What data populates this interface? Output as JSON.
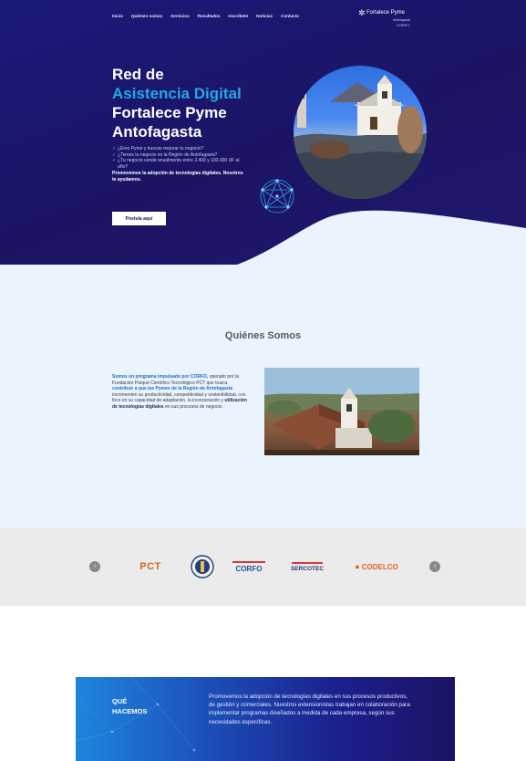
{
  "nav": {
    "items": [
      "Inicio",
      "Quiénes somos",
      "Servicios",
      "Resultados",
      "Inscríbete",
      "Noticias",
      "Contacto"
    ]
  },
  "brand": {
    "mark": "✲",
    "name": "Fortalece Pyme",
    "tagline": "Antofagasta",
    "code": "CORFO"
  },
  "hero": {
    "title_line1": "Red de",
    "title_line2": "Asistencia Digital",
    "title_line3": "Fortalece Pyme",
    "title_line4": "Antofagasta",
    "bullets": [
      "¿Eres Pyme y buscas mejorar tu negocio?",
      "¿Tienes tu negocio en la Región de Antofagasta?",
      "¿Tu negocio vende anualmente entre 2.400 y 100.000 UF al año?"
    ],
    "strong_text": "Promovemos la adopción de tecnologías digitales. Nosotros te ayudamos.",
    "cta": "Postula aquí"
  },
  "quienes": {
    "title": "Quiénes Somos",
    "text_hl": "Somos un programa impulsado por CORFO,",
    "text_mid": "operado por la Fundación Parque Científico Tecnológico PCT que busca",
    "text_bold1": "contribuir a que las Pymes de la Región de Antofagasta",
    "text_rest": "incrementen su productividad, competitividad y sostenibilidad, con foco en su capacidad de adaptación, la incorporación y",
    "text_bold2": "utilización de tecnologías digitales",
    "text_end": "en sus procesos de negocio."
  },
  "logos": {
    "prev": "‹",
    "next": "›",
    "items": [
      "PCT",
      "UCN",
      "CORFO",
      "SERCOTEC",
      "CODELCO"
    ],
    "colors": {
      "pct": "#d2641e",
      "corfo": "#1f4f9a",
      "sercotec": "#2b3a7a",
      "codelco": "#e0651a"
    }
  },
  "que": {
    "title_line1": "QUÉ",
    "title_line2": "HACEMOS",
    "text": "Promovemos la adopción de tecnologías digitales en sus procesos productivos, de gestión y comerciales. Nuestros extensionistas trabajan en colaboración para implementar programas diseñados a medida de cada empresa, según sus necesidades específicas."
  }
}
